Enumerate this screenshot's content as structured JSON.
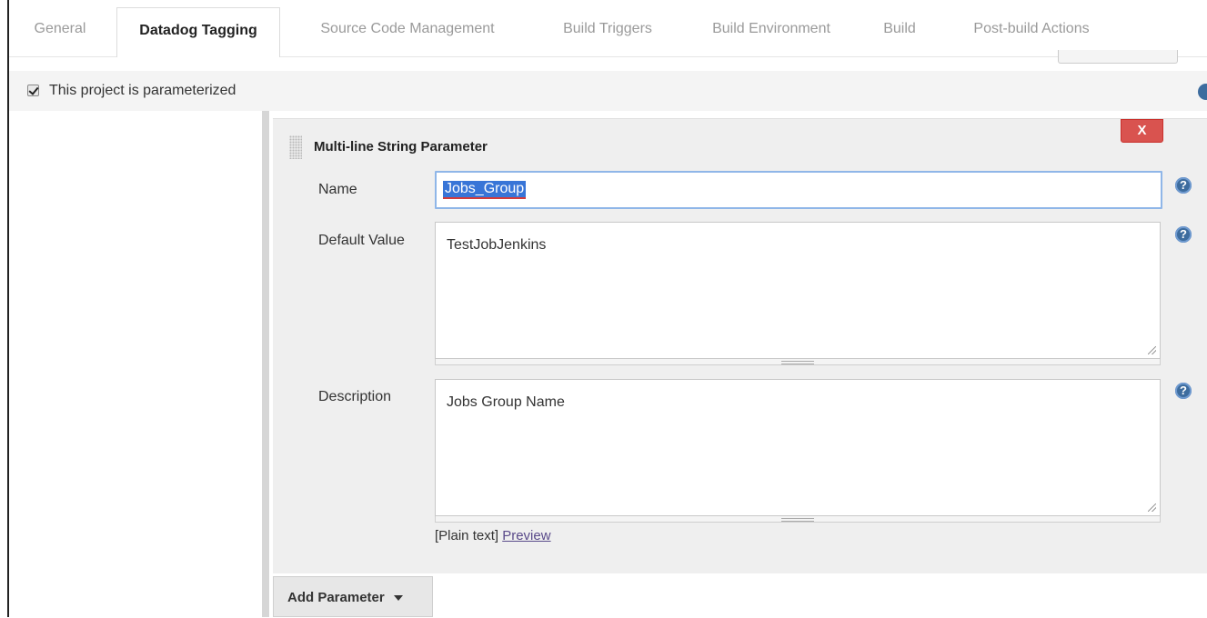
{
  "tabs": [
    {
      "label": "General"
    },
    {
      "label": "Datadog Tagging",
      "active": true
    },
    {
      "label": "Source Code Management"
    },
    {
      "label": "Build Triggers"
    },
    {
      "label": "Build Environment"
    },
    {
      "label": "Build"
    },
    {
      "label": "Post-build Actions"
    }
  ],
  "parameterized": {
    "label": "This project is parameterized",
    "checked": true
  },
  "parameter": {
    "title": "Multi-line String Parameter",
    "delete_label": "X",
    "name_label": "Name",
    "name_value": "Jobs_Group",
    "default_label": "Default Value",
    "default_value": "TestJobJenkins",
    "description_label": "Description",
    "description_value": "Jobs Group Name",
    "plain_text": "[Plain text]",
    "preview_link": "Preview"
  },
  "help_glyph": "?",
  "add_parameter": {
    "label": "Add Parameter"
  },
  "colors": {
    "delete": "#d9534f",
    "help": "#3d6c9e",
    "selection": "#3875d7"
  }
}
